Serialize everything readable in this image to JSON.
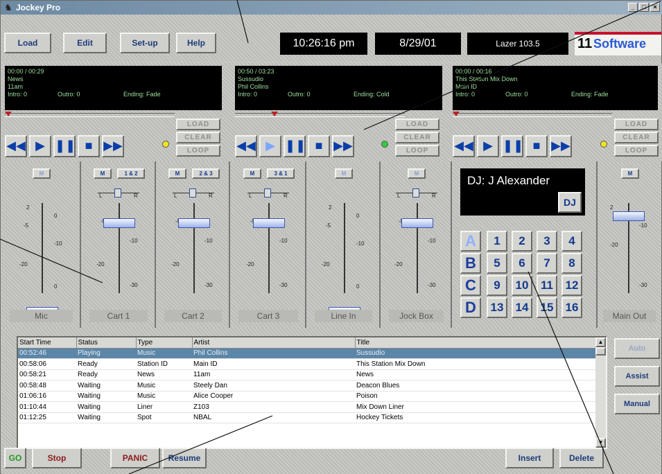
{
  "window": {
    "title": "Jockey Pro",
    "min": "_",
    "max": "□",
    "close": "×"
  },
  "toolbar": {
    "buttons": [
      "Load",
      "Edit",
      "Set-up",
      "Help"
    ],
    "time": "10:26:16 pm",
    "date": "8/29/01",
    "station": "Lazer 103.5",
    "brand_num": "11",
    "brand_word": "Software"
  },
  "players": [
    {
      "time": "00:00 / 00:29",
      "title": "News",
      "artist": "11am",
      "intro": "Intro: 0",
      "outro": "Outro: 0",
      "ending": "Ending: Fade",
      "led": "#f2e51c",
      "progress": 0.0
    },
    {
      "time": "00:50 / 03:23",
      "title": "Sussudio",
      "artist": "Phil Collins",
      "intro": "Intro: 0",
      "outro": "Outro: 0",
      "ending": "Ending: Cold",
      "led": "#2ccf3a",
      "progress": 0.22
    },
    {
      "time": "00:00 / 00:16",
      "title": "This Station Mix Down",
      "artist": "Main ID",
      "intro": "Intro: 0",
      "outro": "Outro: 0",
      "ending": "Ending: Fade",
      "led": "#f2e51c",
      "progress": 0.0
    }
  ],
  "player_buttons": {
    "load": "LOAD",
    "clear": "CLEAR",
    "loop": "LOOP"
  },
  "transport_icons": [
    "rewind-icon",
    "play-icon",
    "pause-icon",
    "stop-icon",
    "fast-forward-icon"
  ],
  "transport_glyphs": [
    "◀◀",
    "▶",
    "❚❚",
    "■",
    "▶▶"
  ],
  "mixer": {
    "mute_label": "M",
    "channels": [
      {
        "label": "Mic",
        "route": "",
        "ticks": [
          "2",
          "0",
          "-5",
          "-10",
          "-20",
          "0"
        ]
      },
      {
        "label": "Cart 1",
        "route": "1 & 2",
        "ticks": [
          "-5",
          "-10",
          "-20",
          "-30"
        ]
      },
      {
        "label": "Cart 2",
        "route": "2 & 3",
        "ticks": [
          "-5",
          "-10",
          "-20",
          "-30"
        ]
      },
      {
        "label": "Cart 3",
        "route": "3 & 1",
        "ticks": [
          "-5",
          "-10",
          "-20",
          "-30"
        ]
      },
      {
        "label": "Line In",
        "route": "",
        "ticks": [
          "2",
          "0",
          "-5",
          "-10",
          "-20",
          "0"
        ]
      },
      {
        "label": "Jock Box",
        "route": "",
        "ticks": [
          "-5",
          "-10",
          "-20",
          "-30"
        ]
      }
    ],
    "pan_left": "L",
    "pan_right": "R",
    "main_label": "Main Out",
    "main_ticks": [
      "2",
      "-10",
      "-20",
      "-30"
    ]
  },
  "dj": {
    "display": "DJ:  J Alexander",
    "button": "DJ",
    "rows": [
      "A",
      "B",
      "C",
      "D"
    ],
    "carts": [
      "1",
      "2",
      "3",
      "4",
      "5",
      "6",
      "7",
      "8",
      "9",
      "10",
      "11",
      "12",
      "13",
      "14",
      "15",
      "16"
    ]
  },
  "log": {
    "columns": [
      "Start Time",
      "Status",
      "Type",
      "Artist",
      "Title"
    ],
    "rows": [
      [
        "00:52:46",
        "Playing",
        "Music",
        "Phil Collins",
        "Sussudio"
      ],
      [
        "00:58:06",
        "Ready",
        "Station ID",
        "Main ID",
        "This Station Mix Down"
      ],
      [
        "00:58:21",
        "Ready",
        "News",
        "11am",
        "News"
      ],
      [
        "00:58:48",
        "Waiting",
        "Music",
        "Steely Dan",
        "Deacon Blues"
      ],
      [
        "01:06:16",
        "Waiting",
        "Music",
        "Alice Cooper",
        "Poison"
      ],
      [
        "01:10:44",
        "Waiting",
        "Liner",
        "Z103",
        "Mix Down Liner"
      ],
      [
        "01:12:25",
        "Waiting",
        "Spot",
        "NBAL",
        "Hockey Tickets"
      ]
    ]
  },
  "side_buttons": [
    "Auto",
    "Assist",
    "Manual"
  ],
  "bottom_buttons": {
    "go": "GO",
    "stop": "Stop",
    "panic": "PANIC",
    "resume": "Resume",
    "insert": "Insert",
    "delete": "Delete"
  }
}
